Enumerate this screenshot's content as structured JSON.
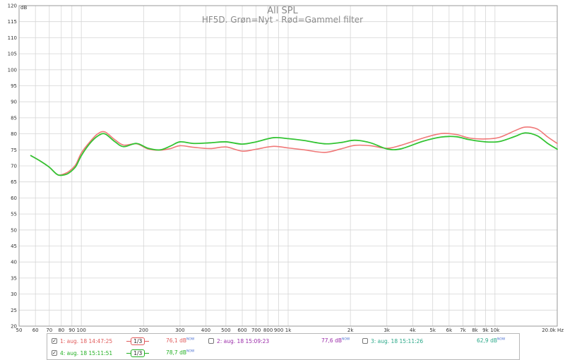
{
  "chart_data": {
    "type": "line",
    "title": "All SPL",
    "subtitle": "HF5D. Grøn=Nyt - Rød=Gammel filter",
    "y_unit": "dB",
    "x_unit": "Hz",
    "xscale": "log",
    "xlim": [
      50,
      20000
    ],
    "ylim": [
      20,
      120
    ],
    "grid": true,
    "y_ticks": [
      20,
      25,
      30,
      35,
      40,
      45,
      50,
      55,
      60,
      65,
      70,
      75,
      80,
      85,
      90,
      95,
      100,
      105,
      110,
      115,
      120
    ],
    "x_ticks": [
      {
        "v": 50,
        "label": "50"
      },
      {
        "v": 60,
        "label": "60"
      },
      {
        "v": 70,
        "label": "70"
      },
      {
        "v": 80,
        "label": "80"
      },
      {
        "v": 90,
        "label": "90"
      },
      {
        "v": 100,
        "label": "100"
      },
      {
        "v": 200,
        "label": "200"
      },
      {
        "v": 300,
        "label": "300"
      },
      {
        "v": 400,
        "label": "400"
      },
      {
        "v": 500,
        "label": "500"
      },
      {
        "v": 600,
        "label": "600"
      },
      {
        "v": 700,
        "label": "700"
      },
      {
        "v": 800,
        "label": "800"
      },
      {
        "v": 900,
        "label": "900"
      },
      {
        "v": 1000,
        "label": "1k"
      },
      {
        "v": 2000,
        "label": "2k"
      },
      {
        "v": 3000,
        "label": "3k"
      },
      {
        "v": 4000,
        "label": "4k"
      },
      {
        "v": 5000,
        "label": "5k"
      },
      {
        "v": 6000,
        "label": "6k"
      },
      {
        "v": 7000,
        "label": "7k"
      },
      {
        "v": 8000,
        "label": "8k"
      },
      {
        "v": 9000,
        "label": "9k"
      },
      {
        "v": 10000,
        "label": "10k"
      },
      {
        "v": 20000,
        "label": "20,0k Hz"
      }
    ],
    "series": [
      {
        "name": "1: aug. 18 14:47:25",
        "color": "#f07878",
        "x": [
          57,
          63,
          70,
          77,
          84,
          88,
          94,
          100,
          110,
          120,
          130,
          145,
          160,
          185,
          210,
          240,
          270,
          300,
          350,
          420,
          500,
          600,
          700,
          850,
          1000,
          1200,
          1500,
          1800,
          2100,
          2500,
          3000,
          3500,
          4500,
          5500,
          6500,
          7500,
          9000,
          10500,
          12500,
          14000,
          16000,
          18000,
          20000
        ],
        "y": [
          73.2,
          71.6,
          69.6,
          67.2,
          67.7,
          68.5,
          70.4,
          74,
          77.5,
          80,
          80.6,
          78.2,
          76.5,
          76.9,
          75.3,
          74.9,
          75.4,
          76.3,
          75.8,
          75.4,
          75.9,
          74.6,
          75.2,
          76.1,
          75.6,
          75,
          74.2,
          75.3,
          76.4,
          76.3,
          75.5,
          76.4,
          78.7,
          80.1,
          79.8,
          78.7,
          78.4,
          78.9,
          81,
          82.1,
          81.5,
          79,
          77
        ]
      },
      {
        "name": "4: aug. 18 15:11:51",
        "color": "#33c433",
        "x": [
          57,
          63,
          70,
          77,
          84,
          88,
          94,
          100,
          110,
          120,
          130,
          145,
          160,
          185,
          210,
          240,
          270,
          300,
          350,
          420,
          500,
          600,
          700,
          850,
          1000,
          1200,
          1500,
          1800,
          2100,
          2500,
          3000,
          3500,
          4500,
          5500,
          6500,
          7500,
          9000,
          10500,
          12500,
          14000,
          16000,
          18000,
          20000
        ],
        "y": [
          73.2,
          71.6,
          69.6,
          67.2,
          67.3,
          68,
          69.8,
          73.2,
          77,
          79.3,
          80,
          77.6,
          76,
          77,
          75.5,
          75,
          76.2,
          77.5,
          77,
          77.2,
          77.5,
          76.8,
          77.5,
          78.8,
          78.5,
          77.9,
          76.9,
          77.3,
          78,
          77.2,
          75.3,
          75.3,
          77.7,
          79,
          79.1,
          78.2,
          77.5,
          77.6,
          79.2,
          80.3,
          79.4,
          77,
          75.2
        ]
      }
    ]
  },
  "legend": [
    {
      "id": 1,
      "label": "1: aug. 18 14:47:25",
      "checked": true,
      "smoothing": "1/3",
      "value": "76,1 dB",
      "unit_tag": "NOW",
      "color": "#e05a5a",
      "text_color": "#e05a5a",
      "show_smoothing": true
    },
    {
      "id": 2,
      "label": "2: aug. 18 15:09:23",
      "checked": false,
      "smoothing": "",
      "value": "77,6 dB",
      "unit_tag": "NOW",
      "color": "#9a2aa8",
      "text_color": "#9a2aa8",
      "show_smoothing": false
    },
    {
      "id": 3,
      "label": "3: aug. 18 15:11:26",
      "checked": false,
      "smoothing": "",
      "value": "62,9 dB",
      "unit_tag": "NOW",
      "color": "#2aa888",
      "text_color": "#2aa888",
      "show_smoothing": false
    },
    {
      "id": 4,
      "label": "4: aug. 18 15:11:51",
      "checked": true,
      "smoothing": "1/3",
      "value": "78,7 dB",
      "unit_tag": "NOW",
      "color": "#22b022",
      "text_color": "#22b022",
      "show_smoothing": true
    }
  ],
  "checkmark": "✓"
}
